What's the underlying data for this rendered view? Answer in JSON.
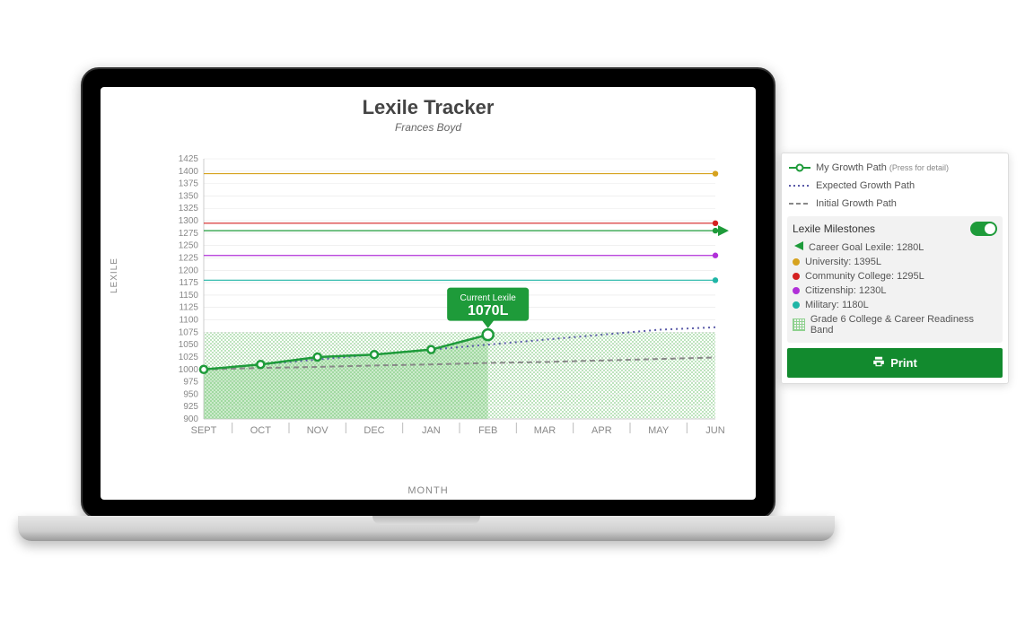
{
  "header": {
    "title": "Lexile Tracker",
    "student": "Frances Boyd"
  },
  "axes": {
    "ylabel": "LEXILE",
    "xlabel": "MONTH"
  },
  "tooltip": {
    "label": "Current Lexile",
    "value": "1070L"
  },
  "legend": {
    "my": {
      "label": "My Growth Path",
      "hint": "(Press for detail)"
    },
    "expected": {
      "label": "Expected Growth Path"
    },
    "initial": {
      "label": "Initial Growth Path"
    }
  },
  "milestones_panel": {
    "title": "Lexile Milestones",
    "items": {
      "career": {
        "label": "Career Goal Lexile: 1280L",
        "color": "#1e9b3a"
      },
      "university": {
        "label": "University: 1395L",
        "color": "#d6a21e"
      },
      "community": {
        "label": "Community College: 1295L",
        "color": "#d42020"
      },
      "citizen": {
        "label": "Citizenship: 1230L",
        "color": "#b030d8"
      },
      "military": {
        "label": "Military: 1180L",
        "color": "#1fb5a6"
      }
    },
    "band_label": "Grade 6 College & Career Readiness Band"
  },
  "print_label": "Print",
  "chart_data": {
    "type": "line",
    "title": "Lexile Tracker",
    "xlabel": "MONTH",
    "ylabel": "LEXILE",
    "categories": [
      "SEPT",
      "OCT",
      "NOV",
      "DEC",
      "JAN",
      "FEB",
      "MAR",
      "APR",
      "MAY",
      "JUN"
    ],
    "ylim": [
      900,
      1425
    ],
    "ytick_step": 25,
    "series": [
      {
        "name": "My Growth Path",
        "values": [
          1000,
          1010,
          1025,
          1030,
          1040,
          1070,
          null,
          null,
          null,
          null
        ]
      },
      {
        "name": "Expected Growth Path",
        "values": [
          1000,
          1010,
          1020,
          1030,
          1040,
          1050,
          1060,
          1070,
          1080,
          1085
        ]
      },
      {
        "name": "Initial Growth Path",
        "values": [
          1000,
          1003,
          1005,
          1008,
          1010,
          1013,
          1015,
          1018,
          1021,
          1024
        ]
      }
    ],
    "readiness_band": {
      "low": 900,
      "high": 1075,
      "label": "Grade 6 College & Career Readiness Band"
    },
    "milestones": [
      {
        "name": "Career Goal Lexile",
        "value": 1280,
        "color": "#1e9b3a"
      },
      {
        "name": "University",
        "value": 1395,
        "color": "#d6a21e"
      },
      {
        "name": "Community College",
        "value": 1295,
        "color": "#d42020"
      },
      {
        "name": "Citizenship",
        "value": 1230,
        "color": "#b030d8"
      },
      {
        "name": "Military",
        "value": 1180,
        "color": "#1fb5a6"
      }
    ],
    "current_point": {
      "month": "FEB",
      "value": 1070
    }
  }
}
